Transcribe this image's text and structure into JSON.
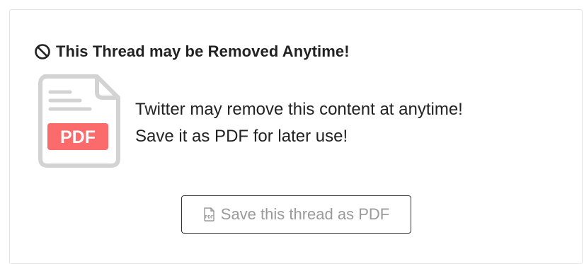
{
  "notice": {
    "title": "This Thread may be Removed Anytime!",
    "title_icon": "ban-icon",
    "message_line1": "Twitter may remove this content at anytime!",
    "message_line2": "Save it as PDF for later use!",
    "pdf_badge_text": "PDF",
    "pdf_badge_color": "#fb6b6b",
    "file_outline_color": "#d3d3d3"
  },
  "save_button": {
    "icon": "pdf-file-icon",
    "label": "Save this thread as PDF"
  }
}
